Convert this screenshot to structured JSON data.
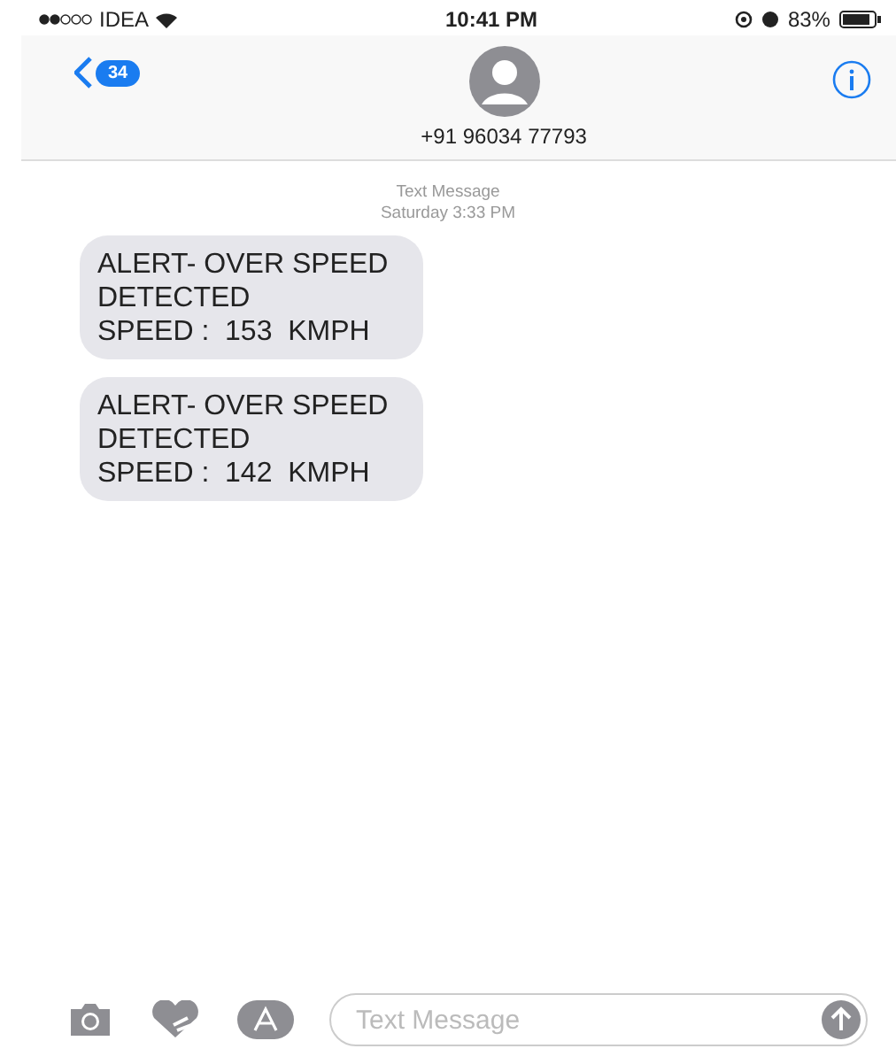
{
  "status_bar": {
    "carrier": "IDEA",
    "time": "10:41 PM",
    "battery": "83%"
  },
  "header": {
    "unread_count": "34",
    "contact": "+91 96034 77793"
  },
  "conversation": {
    "service": "Text Message",
    "timestamp": "Saturday 3:33 PM",
    "messages": [
      {
        "lines": [
          "ALERT- OVER SPEED",
          "DETECTED",
          "SPEED :  153  KMPH"
        ]
      },
      {
        "lines": [
          "ALERT- OVER SPEED",
          "DETECTED",
          "SPEED :  142  KMPH"
        ]
      }
    ]
  },
  "composer": {
    "placeholder": "Text Message"
  }
}
